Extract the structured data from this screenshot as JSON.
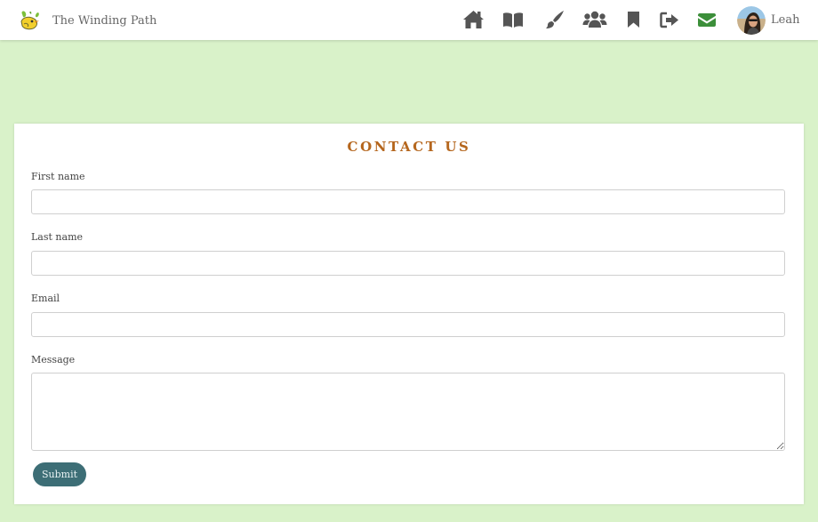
{
  "navbar": {
    "brand_name": "The Winding Path",
    "logo_icon": "leaf-bird-logo",
    "icons": [
      {
        "name": "home-icon",
        "color": "#555555"
      },
      {
        "name": "book-icon",
        "color": "#555555"
      },
      {
        "name": "paintbrush-icon",
        "color": "#555555"
      },
      {
        "name": "users-icon",
        "color": "#555555"
      },
      {
        "name": "bookmark-icon",
        "color": "#555555"
      },
      {
        "name": "sign-out-icon",
        "color": "#555555"
      },
      {
        "name": "envelope-icon",
        "color": "#3c8f3a"
      }
    ],
    "user": {
      "name": "Leah",
      "avatar_icon": "avatar"
    }
  },
  "contact_form": {
    "title": "CONTACT US",
    "first_name": {
      "label": "First name",
      "value": "",
      "placeholder": ""
    },
    "last_name": {
      "label": "Last name",
      "value": "",
      "placeholder": ""
    },
    "email": {
      "label": "Email",
      "value": "",
      "placeholder": ""
    },
    "message": {
      "label": "Message",
      "value": "",
      "placeholder": ""
    },
    "submit_label": "Submit"
  },
  "colors": {
    "background": "#d9f2c9",
    "accent_title": "#b5661d",
    "submit_button": "#3d6e76",
    "active_nav": "#3c8f3a"
  }
}
